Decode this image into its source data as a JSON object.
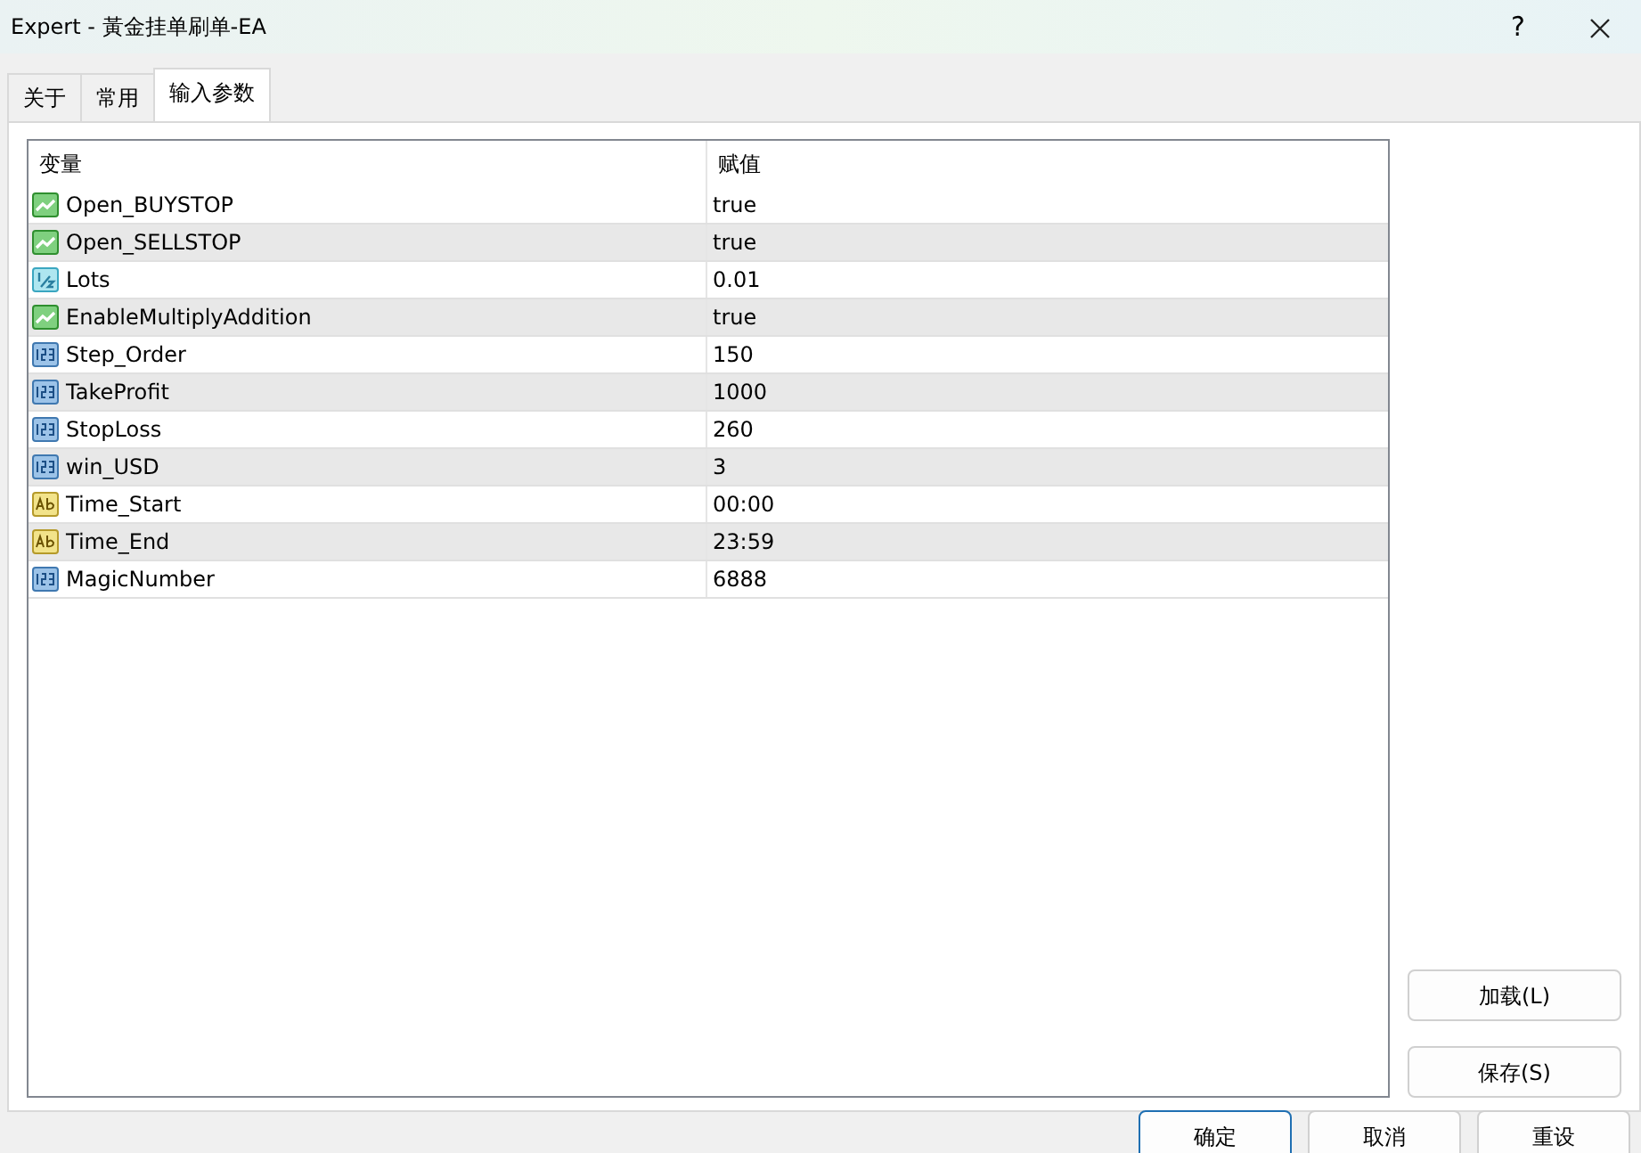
{
  "window": {
    "title": "Expert - 黃金挂单刷单-EA",
    "help": "?"
  },
  "tabs": [
    {
      "label": "关于",
      "selected": false
    },
    {
      "label": "常用",
      "selected": false
    },
    {
      "label": "输入参数",
      "selected": true
    }
  ],
  "table": {
    "columns": [
      "变量",
      "赋值"
    ],
    "rows": [
      {
        "kind": "bool",
        "name": "Open_BUYSTOP",
        "value": "true"
      },
      {
        "kind": "bool",
        "name": "Open_SELLSTOP",
        "value": "true"
      },
      {
        "kind": "double",
        "name": "Lots",
        "value": "0.01"
      },
      {
        "kind": "bool",
        "name": "EnableMultiplyAddition",
        "value": "true"
      },
      {
        "kind": "int",
        "name": "Step_Order",
        "value": "150"
      },
      {
        "kind": "int",
        "name": "TakeProfit",
        "value": "1000"
      },
      {
        "kind": "int",
        "name": "StopLoss",
        "value": "260"
      },
      {
        "kind": "int",
        "name": "win_USD",
        "value": "3"
      },
      {
        "kind": "string",
        "name": "Time_Start",
        "value": "00:00"
      },
      {
        "kind": "string",
        "name": "Time_End",
        "value": "23:59"
      },
      {
        "kind": "int",
        "name": "MagicNumber",
        "value": "6888"
      }
    ]
  },
  "side_buttons": [
    "加载(L)",
    "保存(S)"
  ],
  "buttons": [
    {
      "label": "确定",
      "focused": true
    },
    {
      "label": "取消",
      "focused": false
    },
    {
      "label": "重设",
      "focused": false
    }
  ]
}
